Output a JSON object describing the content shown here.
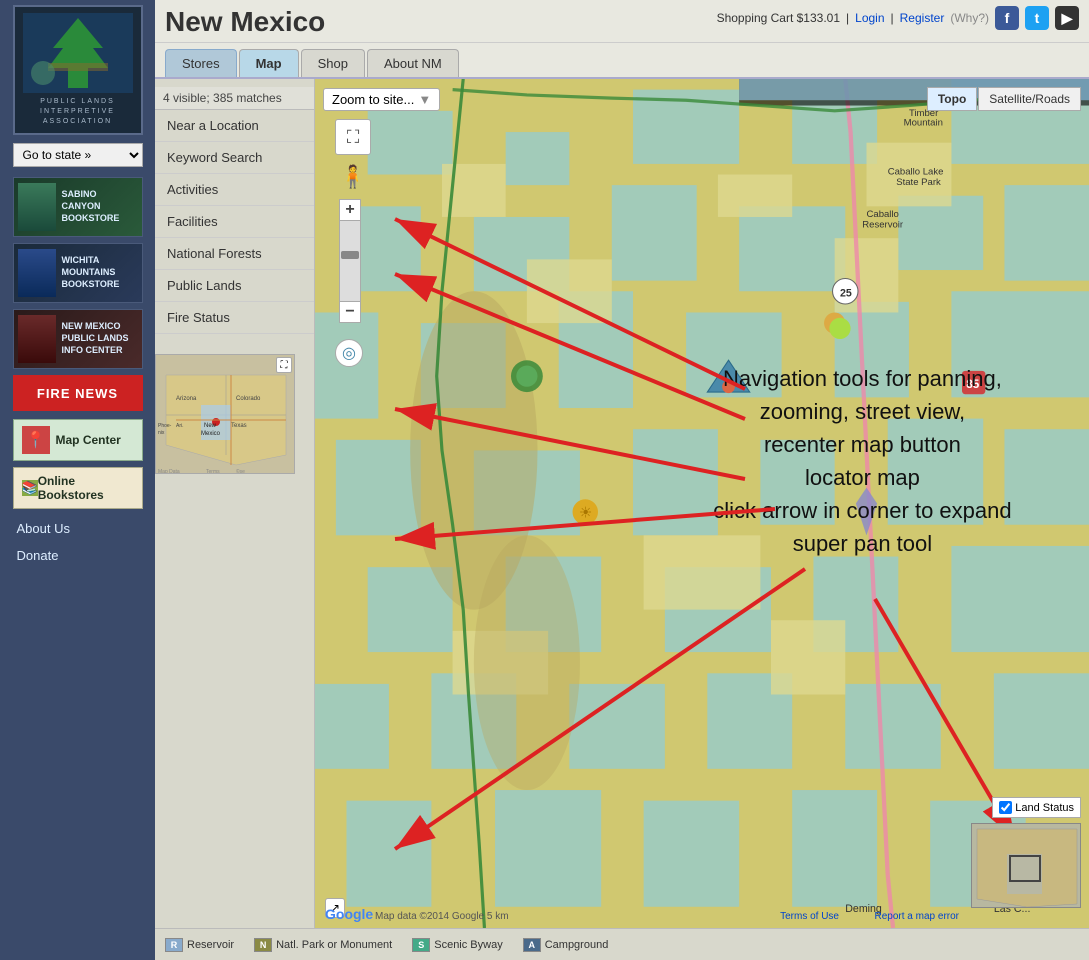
{
  "sidebar": {
    "logo_text": "PUBLIC LANDS\nINTERPRETIVE\nASSOCIATION",
    "state_selector": {
      "label": "Go to state »",
      "placeholder": "Go to state »"
    },
    "stores": [
      {
        "name": "SABINO CANYON BOOKSTORE",
        "class": "sabino"
      },
      {
        "name": "WICHITA MOUNTAINS BOOKSTORE",
        "class": "wichita"
      },
      {
        "name": "NEW MEXICO PUBLIC LANDS INFO CENTER",
        "class": "newmexico"
      }
    ],
    "fire_news_label": "FIRE NEWS",
    "map_center_label": "Map Center",
    "online_bookstores_label": "Online Bookstores",
    "about_us_label": "About Us",
    "donate_label": "Donate"
  },
  "header": {
    "title": "New Mexico",
    "cart": "Shopping Cart $133.01",
    "login": "Login",
    "register": "Register",
    "register_why": "(Why?)",
    "social": {
      "facebook": "f",
      "twitter": "t",
      "youtube": "▶"
    }
  },
  "tabs": [
    {
      "id": "stores",
      "label": "Stores",
      "active": false
    },
    {
      "id": "map",
      "label": "Map",
      "active": true
    },
    {
      "id": "shop",
      "label": "Shop",
      "active": false
    },
    {
      "id": "about",
      "label": "About NM",
      "active": false
    }
  ],
  "map": {
    "match_info": "4 visible; 385 matches",
    "zoom_to_site_placeholder": "Zoom to site...",
    "map_type_topo": "Topo",
    "map_type_satellite": "Satellite/Roads",
    "left_panel_items": [
      "Near a Location",
      "Keyword Search",
      "Activities",
      "Facilities",
      "National Forests",
      "Public Lands",
      "Fire Status"
    ],
    "overlay_text_line1": "Navigation tools for panning,",
    "overlay_text_line2": "zooming, street view,",
    "overlay_text_line3": "recenter map button",
    "overlay_text_line4": "locator map",
    "overlay_text_line5": "click arrow in corner to expand",
    "overlay_text_line6": "super pan tool",
    "land_status_label": "Land Status",
    "google_label": "Google",
    "map_data_label": "Map data ©2014 Google  5 km",
    "terms_label": "Terms of Use",
    "report_error": "Report a map error"
  },
  "legend": {
    "items": [
      {
        "icon": "R",
        "label": "Reservoir"
      },
      {
        "icon": "N",
        "label": "Natl. Park or Monument"
      },
      {
        "icon": "S",
        "label": "Scenic Byway"
      },
      {
        "icon": "A",
        "label": "Campground"
      }
    ]
  }
}
